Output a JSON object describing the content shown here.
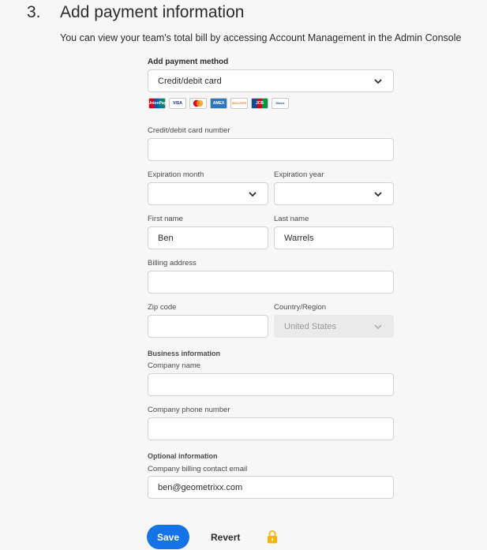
{
  "header": {
    "step_number": "3.",
    "title": "Add payment information",
    "subtitle": "You can view your team's total bill by accessing Account Management in the Admin Console"
  },
  "payment_method": {
    "label": "Add payment method",
    "selected": "Credit/debit card",
    "card_icons": [
      "unionpay-icon",
      "visa-icon",
      "mastercard-icon",
      "amex-icon",
      "discover-icon",
      "jcb-icon",
      "diners-club-icon"
    ],
    "card_texts": [
      "UnionPay",
      "VISA",
      "",
      "AMEX",
      "DISCOVER",
      "JCB",
      "Diners"
    ]
  },
  "card_number": {
    "label": "Credit/debit card number",
    "value": ""
  },
  "expiration_month": {
    "label": "Expiration month",
    "value": ""
  },
  "expiration_year": {
    "label": "Expiration year",
    "value": ""
  },
  "first_name": {
    "label": "First name",
    "value": "Ben"
  },
  "last_name": {
    "label": "Last name",
    "value": "Warrels"
  },
  "billing_address": {
    "label": "Billing address",
    "value": ""
  },
  "zip_code": {
    "label": "Zip code",
    "value": ""
  },
  "country": {
    "label": "Country/Region",
    "value": "United States"
  },
  "business": {
    "section_label": "Business information",
    "company_name_label": "Company name",
    "company_name_value": "",
    "company_phone_label": "Company phone number",
    "company_phone_value": ""
  },
  "optional": {
    "section_label": "Optional information",
    "email_label": "Company billing contact email",
    "email_value": "ben@geometrixx.com"
  },
  "actions": {
    "save_label": "Save",
    "revert_label": "Revert"
  },
  "colors": {
    "accent": "#1473e6",
    "lock": "#f5b700"
  }
}
